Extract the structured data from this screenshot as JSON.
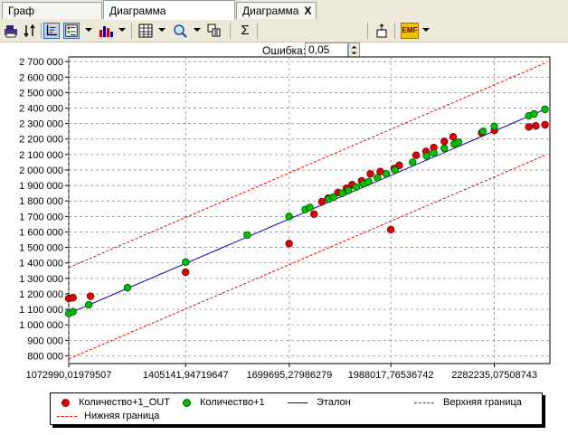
{
  "tabs": [
    {
      "label": "Граф нейросети",
      "active": false
    },
    {
      "label": "Диаграмма рассеяния",
      "active": true
    },
    {
      "label": "Диаграмма",
      "active": false
    }
  ],
  "tab_close_glyph": "X",
  "toolbar": {
    "error_label": "Ошибка:",
    "error_value": "0,05",
    "sum_glyph": "Σ",
    "emf_label": "EMF",
    "icons": [
      "printer-icon",
      "sort-icon",
      "axes-icon",
      "legend-icon",
      "chart-type-icon",
      "table-icon",
      "zoom-icon",
      "copy-icon",
      "sum-icon",
      "spin-icon",
      "cursor-icon",
      "emf-export-icon"
    ]
  },
  "colors": {
    "out_points": "#e00000",
    "target_points": "#00c000",
    "reference_line": "#0000c0",
    "bounds": "#e00000",
    "grid": "#808080"
  },
  "chart_data": {
    "type": "scatter",
    "title": "",
    "xlabel": "",
    "ylabel": "",
    "xlim": [
      1072990.01979507,
      2440000
    ],
    "ylim": [
      750000,
      2730000
    ],
    "y_ticks": [
      800000,
      900000,
      1000000,
      1100000,
      1200000,
      1300000,
      1400000,
      1500000,
      1600000,
      1700000,
      1800000,
      1900000,
      2000000,
      2100000,
      2200000,
      2300000,
      2400000,
      2500000,
      2600000,
      2700000
    ],
    "y_tick_labels": [
      "800 000",
      "900 000",
      "1 000 000",
      "1 100 000",
      "1 200 000",
      "1 300 000",
      "1 400 000",
      "1 500 000",
      "1 600 000",
      "1 700 000",
      "1 800 000",
      "1 900 000",
      "2 000 000",
      "2 100 000",
      "2 200 000",
      "2 300 000",
      "2 400 000",
      "2 500 000",
      "2 600 000",
      "2 700 000"
    ],
    "x_ticks": [
      1072990.01979507,
      1405141.94719647,
      1699695.27986279,
      1988017.76536742,
      2282235.07508743
    ],
    "x_tick_labels": [
      "1072990,01979507",
      "1405141,94719647",
      "1699695,27986279",
      "1988017,76536742",
      "2282235,07508743"
    ],
    "grid": true,
    "legend_position": "bottom",
    "series": [
      {
        "name": "Количество+1_OUT",
        "kind": "points",
        "color": "#e00000",
        "points": [
          [
            1072990,
            1170000
          ],
          [
            1085000,
            1175000
          ],
          [
            1135000,
            1185000
          ],
          [
            1405000,
            1340000
          ],
          [
            1699000,
            1525000
          ],
          [
            1988000,
            1615000
          ],
          [
            1770000,
            1715000
          ],
          [
            1792000,
            1795000
          ],
          [
            1810000,
            1818000
          ],
          [
            1838000,
            1855000
          ],
          [
            1862000,
            1882000
          ],
          [
            1878000,
            1905000
          ],
          [
            1905000,
            1930000
          ],
          [
            1930000,
            1975000
          ],
          [
            1958000,
            1990000
          ],
          [
            1998000,
            2010000
          ],
          [
            2012000,
            2030000
          ],
          [
            2060000,
            2095000
          ],
          [
            2088000,
            2120000
          ],
          [
            2110000,
            2145000
          ],
          [
            2140000,
            2185000
          ],
          [
            2165000,
            2215000
          ],
          [
            2246000,
            2240000
          ],
          [
            2282000,
            2255000
          ],
          [
            2380000,
            2278000
          ],
          [
            2400000,
            2285000
          ],
          [
            2426000,
            2292000
          ]
        ]
      },
      {
        "name": "Количество+1",
        "kind": "points",
        "color": "#00c000",
        "points": [
          [
            1072990,
            1073000
          ],
          [
            1085000,
            1085000
          ],
          [
            1130000,
            1130000
          ],
          [
            1240000,
            1240000
          ],
          [
            1405000,
            1405000
          ],
          [
            1580000,
            1580000
          ],
          [
            1699000,
            1700000
          ],
          [
            1745000,
            1745000
          ],
          [
            1758000,
            1758000
          ],
          [
            1812000,
            1812000
          ],
          [
            1825000,
            1825000
          ],
          [
            1850000,
            1850000
          ],
          [
            1868000,
            1868000
          ],
          [
            1890000,
            1890000
          ],
          [
            1910000,
            1910000
          ],
          [
            1925000,
            1925000
          ],
          [
            1950000,
            1950000
          ],
          [
            1975000,
            1975000
          ],
          [
            2000000,
            2000000
          ],
          [
            2050000,
            2050000
          ],
          [
            2090000,
            2090000
          ],
          [
            2110000,
            2110000
          ],
          [
            2140000,
            2140000
          ],
          [
            2168000,
            2168000
          ],
          [
            2180000,
            2180000
          ],
          [
            2250000,
            2250000
          ],
          [
            2282000,
            2282000
          ],
          [
            2380000,
            2350000
          ],
          [
            2395000,
            2362000
          ],
          [
            2426000,
            2392000
          ]
        ]
      },
      {
        "name": "Эталон",
        "kind": "line",
        "color": "#0000c0",
        "dash": "solid",
        "points": [
          [
            1072990,
            1073000
          ],
          [
            2426000,
            2392000
          ]
        ]
      },
      {
        "name": "Верхняя граница",
        "kind": "line",
        "color": "#e00000",
        "dash": "dashed",
        "points": [
          [
            1072990,
            1370000
          ],
          [
            2426000,
            2690000
          ]
        ]
      },
      {
        "name": "Нижняя граница",
        "kind": "line",
        "color": "#e00000",
        "dash": "dashed",
        "points": [
          [
            1072990,
            780000
          ],
          [
            2426000,
            2095000
          ]
        ]
      }
    ]
  }
}
